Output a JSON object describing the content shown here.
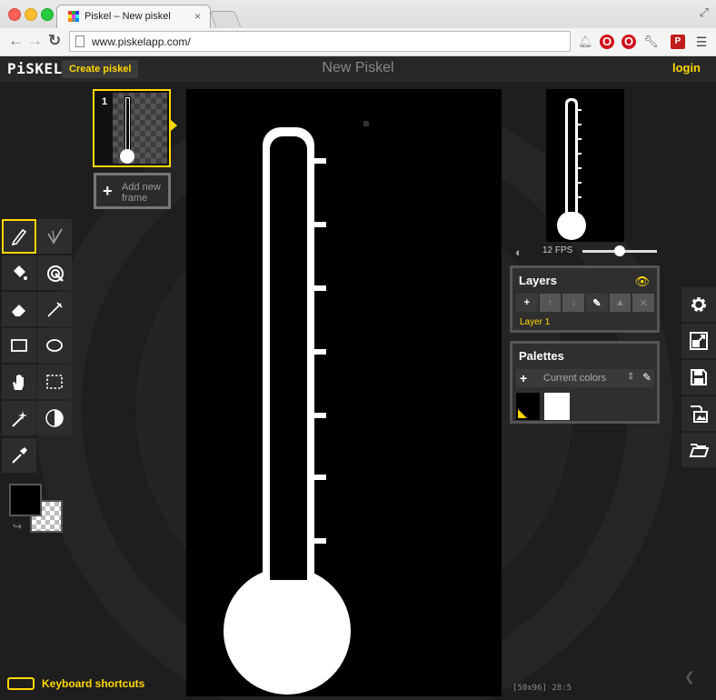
{
  "browser": {
    "tab_title": "Piskel – New piskel",
    "tab_close": "×",
    "url": "www.piskelapp.com/",
    "ext_red_badge": "P"
  },
  "app": {
    "logo": "PiSKEL",
    "create_button": "Create piskel",
    "title": "New Piskel",
    "login": "login"
  },
  "tools": [
    {
      "name": "pen-tool",
      "icon": "pen-icon",
      "active": true
    },
    {
      "name": "vertical-mirror-pen-tool",
      "icon": "mirror-pen-icon",
      "active": false
    },
    {
      "name": "paint-bucket-tool",
      "icon": "bucket-icon",
      "active": false
    },
    {
      "name": "paint-all-same-color-tool",
      "icon": "magic-bucket-icon",
      "active": false
    },
    {
      "name": "eraser-tool",
      "icon": "eraser-icon",
      "active": false
    },
    {
      "name": "stroke-tool",
      "icon": "stroke-icon",
      "active": false
    },
    {
      "name": "rectangle-tool",
      "icon": "rectangle-icon",
      "active": false
    },
    {
      "name": "circle-tool",
      "icon": "circle-icon",
      "active": false
    },
    {
      "name": "move-tool",
      "icon": "hand-icon",
      "active": false
    },
    {
      "name": "rectangle-select-tool",
      "icon": "dashed-rect-icon",
      "active": false
    },
    {
      "name": "shape-select-tool",
      "icon": "wand-icon",
      "active": false
    },
    {
      "name": "lighten-tool",
      "icon": "contrast-icon",
      "active": false
    },
    {
      "name": "color-picker-tool",
      "icon": "eyedropper-icon",
      "active": false
    }
  ],
  "colors": {
    "primary": "#000000",
    "secondary": "transparent",
    "accent": "#ffd700"
  },
  "shortcuts_label": "Keyboard shortcuts",
  "frames": {
    "items": [
      {
        "number": "1"
      }
    ],
    "add_label": "Add new frame"
  },
  "preview": {
    "fps_label": "12 FPS",
    "fps_value": 12,
    "fps_max": 24
  },
  "layers": {
    "title": "Layers",
    "buttons": [
      "+",
      "↑",
      "↓",
      "✎",
      "▲",
      "✕"
    ],
    "items": [
      "Layer 1"
    ]
  },
  "palettes": {
    "title": "Palettes",
    "current": "Current colors",
    "swatches": [
      "#000000",
      "#ffffff"
    ]
  },
  "status": {
    "size": "[50x96]",
    "coords": "28:5"
  }
}
